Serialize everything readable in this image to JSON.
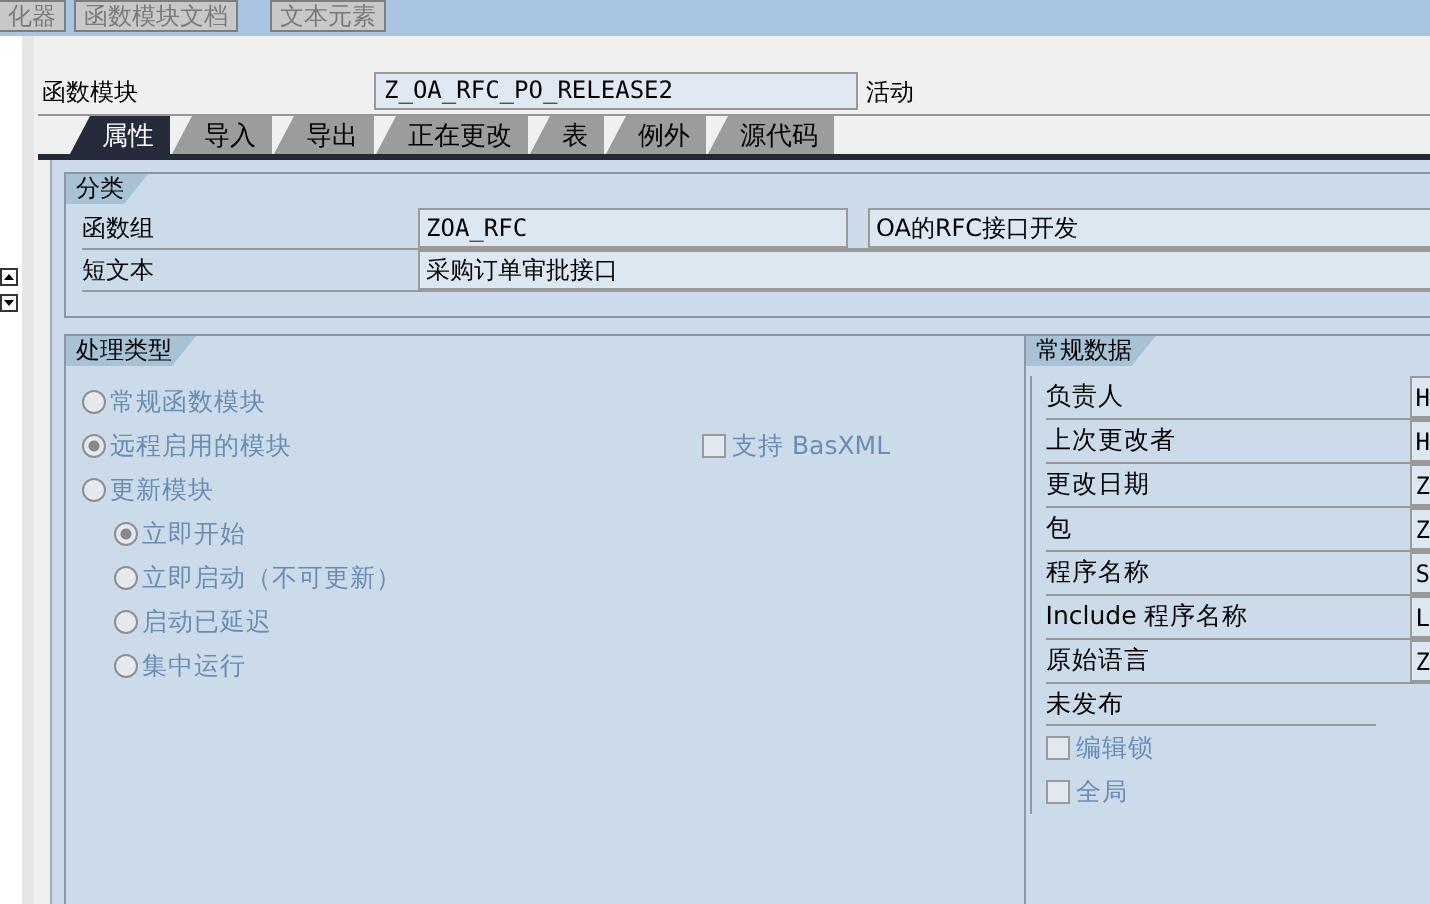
{
  "toolbar": {
    "buttons": [
      "化器",
      "函数模块文档",
      "文本元素"
    ]
  },
  "header": {
    "label": "函数模块",
    "value": "Z_OA_RFC_PO_RELEASE2",
    "status": "活动"
  },
  "tabs": [
    {
      "label": "属性",
      "selected": true
    },
    {
      "label": "导入",
      "selected": false
    },
    {
      "label": "导出",
      "selected": false
    },
    {
      "label": "正在更改",
      "selected": false
    },
    {
      "label": "表",
      "selected": false
    },
    {
      "label": "例外",
      "selected": false
    },
    {
      "label": "源代码",
      "selected": false
    }
  ],
  "classification": {
    "title": "分类",
    "function_group": {
      "label": "函数组",
      "value": "ZOA_RFC",
      "description": "OA的RFC接口开发"
    },
    "short_text": {
      "label": "短文本",
      "value": "采购订单审批接口"
    }
  },
  "processing_type": {
    "title": "处理类型",
    "options": [
      {
        "label": "常规函数模块",
        "selected": false,
        "disabled": true
      },
      {
        "label": "远程启用的模块",
        "selected": true,
        "disabled": true
      },
      {
        "label": "更新模块",
        "selected": false,
        "disabled": true,
        "children": [
          {
            "label": "立即开始",
            "selected": true,
            "disabled": true
          },
          {
            "label": "立即启动（不可更新）",
            "selected": false,
            "disabled": true
          },
          {
            "label": "启动已延迟",
            "selected": false,
            "disabled": true
          },
          {
            "label": "集中运行",
            "selected": false,
            "disabled": true
          }
        ]
      }
    ],
    "basxml": {
      "label": "支持 BasXML",
      "checked": false,
      "disabled": true
    }
  },
  "general_data": {
    "title": "常规数据",
    "fields": [
      {
        "label": "负责人",
        "value": "H"
      },
      {
        "label": "上次更改者",
        "value": "H"
      },
      {
        "label": "更改日期",
        "value": "Z"
      },
      {
        "label": "包",
        "value": "Z"
      },
      {
        "label": "程序名称",
        "value": "S"
      },
      {
        "label": "Include 程序名称",
        "value": "L"
      },
      {
        "label": "原始语言",
        "value": "Z"
      }
    ],
    "release_label": "未发布",
    "checkboxes": [
      {
        "label": "编辑锁",
        "checked": false,
        "disabled": true
      },
      {
        "label": "全局",
        "checked": false,
        "disabled": true
      }
    ]
  }
}
